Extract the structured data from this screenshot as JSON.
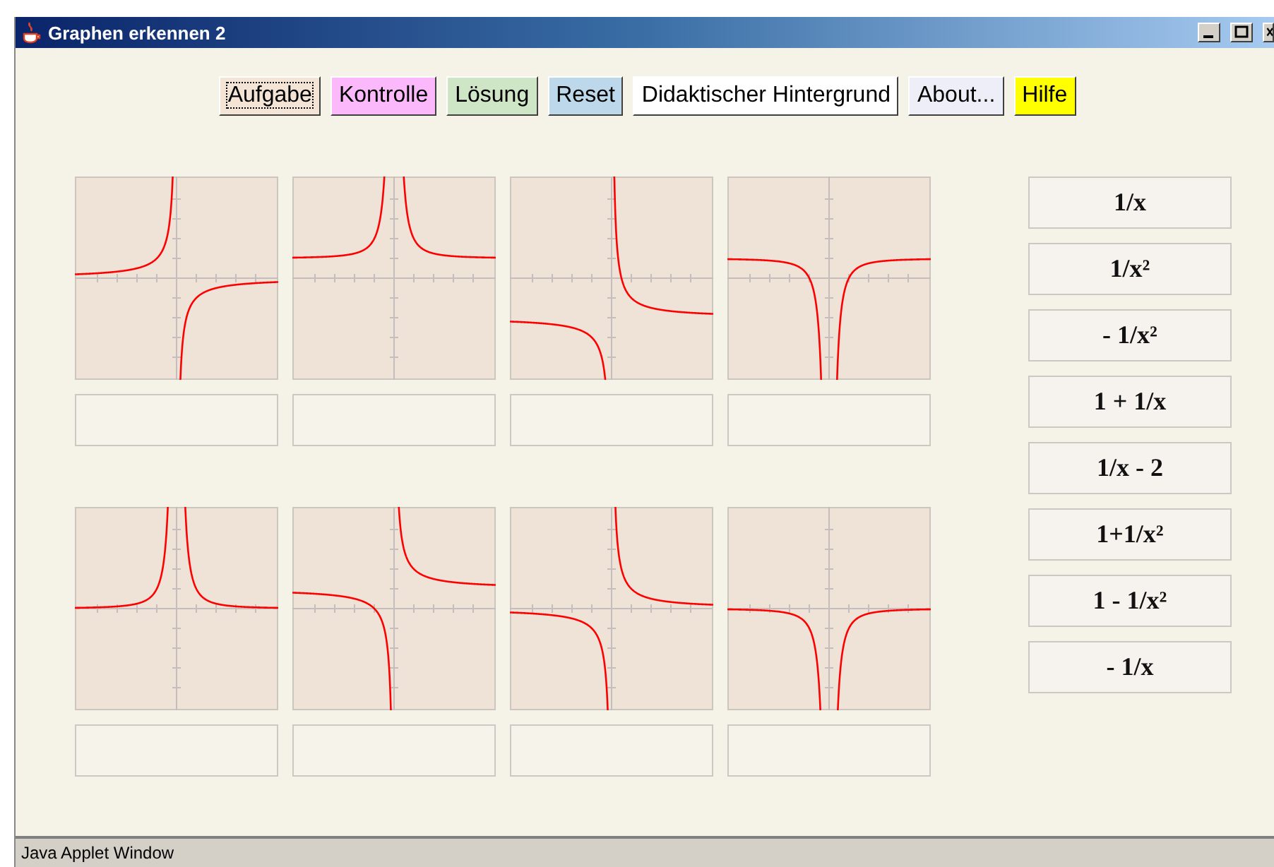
{
  "window": {
    "title": "Graphen erkennen 2"
  },
  "toolbar": [
    {
      "label": "Aufgabe",
      "color": "#f3e4d6",
      "focused": true
    },
    {
      "label": "Kontrolle",
      "color": "#fbb9fb",
      "focused": false
    },
    {
      "label": "Lösung",
      "color": "#cfe6c6",
      "focused": false
    },
    {
      "label": "Reset",
      "color": "#bcd8ea",
      "focused": false
    },
    {
      "label": "Didaktischer Hintergrund",
      "color": "#ffffff",
      "focused": false
    },
    {
      "label": "About...",
      "color": "#eeeef8",
      "focused": false
    },
    {
      "label": "Hilfe",
      "color": "#ffff00",
      "focused": false
    }
  ],
  "plots": [
    {
      "kind": "graph"
    },
    {
      "kind": "graph"
    },
    {
      "kind": "graph"
    },
    {
      "kind": "graph"
    },
    {
      "kind": "graph"
    },
    {
      "kind": "graph"
    },
    {
      "kind": "graph"
    },
    {
      "kind": "graph"
    }
  ],
  "formulas": [
    "1/x",
    "1/x²",
    "- 1/x²",
    "1 + 1/x",
    "1/x - 2",
    "1+1/x²",
    "1 - 1/x²",
    "- 1/x"
  ],
  "status_bar": "Java Applet Window"
}
